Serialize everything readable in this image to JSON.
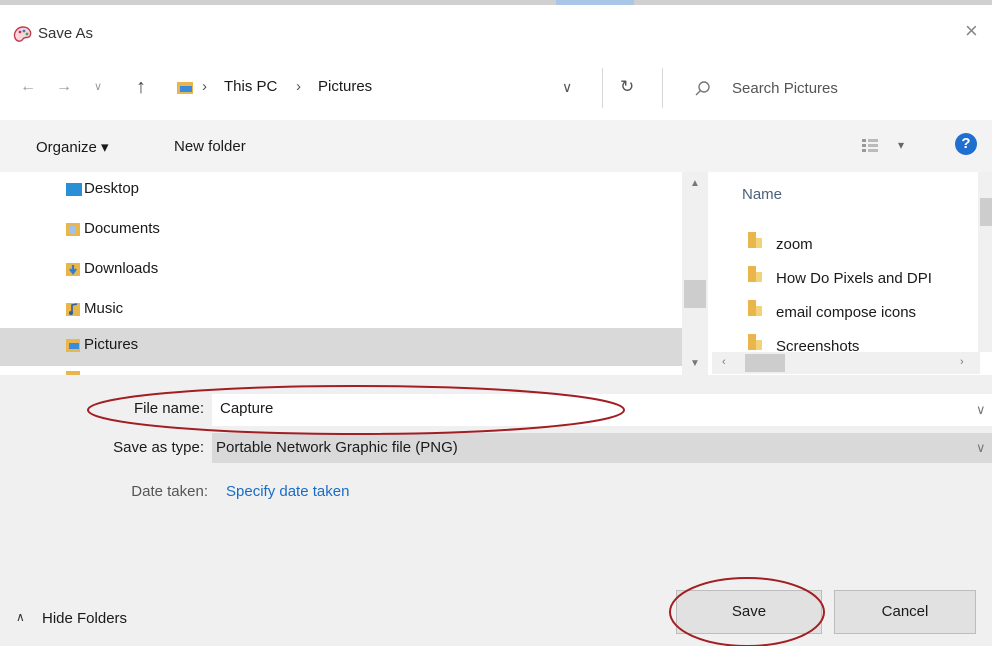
{
  "window": {
    "title": "Save As",
    "close_icon": "close-icon",
    "app_icon": "paint-icon"
  },
  "nav": {
    "back_icon": "back-arrow-icon",
    "forward_icon": "forward-arrow-icon",
    "recent_icon": "chevron-down-icon",
    "up_icon": "up-arrow-icon",
    "breadcrumb": [
      "This PC",
      "Pictures"
    ],
    "separator": "›",
    "refresh_icon": "refresh-icon",
    "search_placeholder": "Search Pictures"
  },
  "toolbar": {
    "organize": "Organize ▾",
    "new_folder": "New folder",
    "view_icon": "view-options-icon",
    "help": "?"
  },
  "nav_pane": {
    "items": [
      {
        "label": "Desktop",
        "icon": "desktop-folder-icon",
        "color": "#2b8fd8"
      },
      {
        "label": "Documents",
        "icon": "documents-folder-icon",
        "color": "#6b9fd1"
      },
      {
        "label": "Downloads",
        "icon": "downloads-folder-icon",
        "color": "#2d7dd2"
      },
      {
        "label": "Music",
        "icon": "music-folder-icon",
        "color": "#e8a33a"
      },
      {
        "label": "Pictures",
        "icon": "pictures-folder-icon",
        "color": "#5aa0e0",
        "selected": true
      }
    ]
  },
  "file_list": {
    "column": "Name",
    "items": [
      "zoom",
      "How Do Pixels and DPI",
      "email compose icons",
      "Screenshots"
    ]
  },
  "form": {
    "file_name_label": "File name:",
    "file_name_value": "Capture",
    "save_type_label": "Save as type:",
    "save_type_value": "Portable Network Graphic file (PNG)",
    "date_label": "Date taken:",
    "date_link": "Specify date taken"
  },
  "footer": {
    "hide_folders": "Hide Folders",
    "save": "Save",
    "cancel": "Cancel"
  },
  "colors": {
    "accent": "#1a6cc8",
    "annotation": "#a11e22",
    "folder": "#e8b64a"
  }
}
